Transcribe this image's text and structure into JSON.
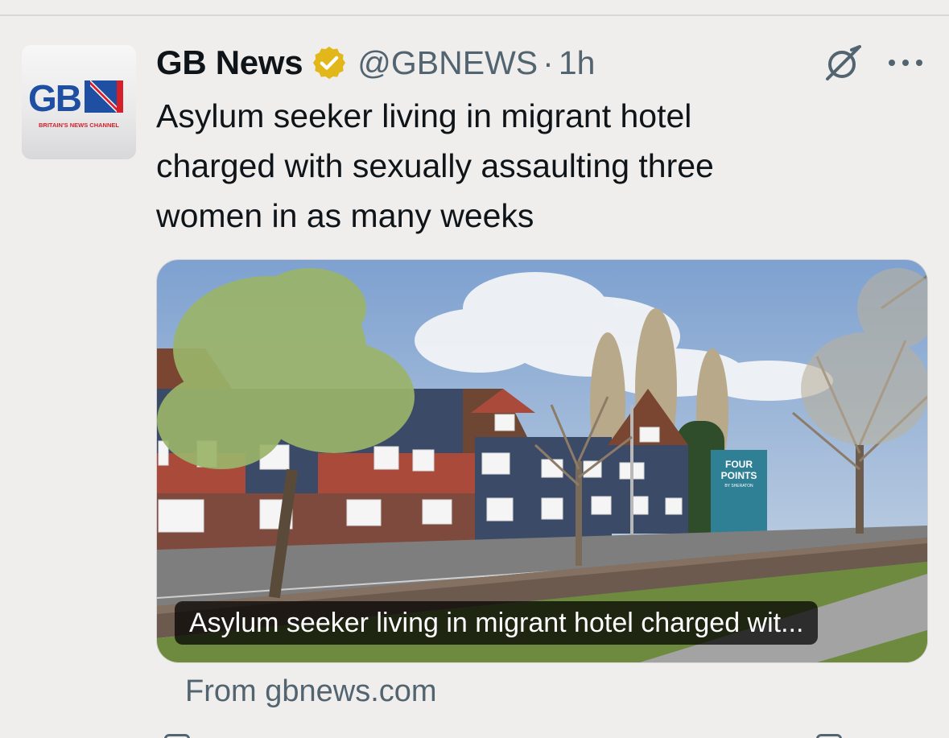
{
  "tweet": {
    "display_name": "GB News",
    "handle": "@GBNEWS",
    "separator": "·",
    "timestamp": "1h",
    "text": "Asylum seeker living in migrant hotel\ncharged with sexually assaulting three\nwomen in as many weeks"
  },
  "avatar": {
    "logo_text": "GBN",
    "tagline": "BRITAIN'S NEWS CHANNEL"
  },
  "icons": {
    "verified": "verified-gold-badge-icon",
    "grok": "grok-icon",
    "more": "more-horizontal-icon"
  },
  "card": {
    "title": "Asylum seeker living in migrant hotel charged wit...",
    "source": "From gbnews.com",
    "sign_text_line1": "FOUR",
    "sign_text_line2": "POINTS",
    "sign_text_line3": "BY SHERATON"
  },
  "colors": {
    "background": "#efeeec",
    "text_primary": "#0f1419",
    "text_secondary": "#536471",
    "verified_gold": "#e2b719",
    "gbn_blue": "#1e4fa3",
    "gbn_red": "#d4202a"
  }
}
